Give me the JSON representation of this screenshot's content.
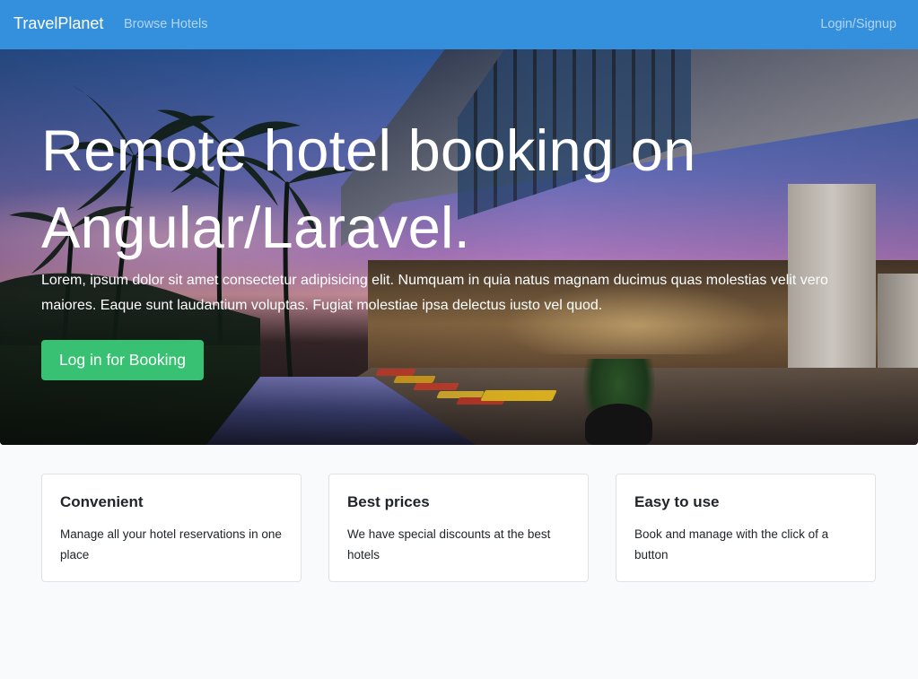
{
  "navbar": {
    "brand": "TravelPlanet",
    "browse_label": "Browse Hotels",
    "login_label": "Login/Signup"
  },
  "hero": {
    "title": "Remote hotel booking on Angular/Laravel.",
    "text": "Lorem, ipsum dolor sit amet consectetur adipisicing elit. Numquam in quia natus magnam ducimus quas molestias velit vero maiores. Eaque sunt laudantium voluptas. Fugiat molestiae ipsa delectus iusto vel quod.",
    "button_label": "Log in for Booking"
  },
  "features": [
    {
      "title": "Convenient",
      "text": "Manage all your hotel reservations in one place"
    },
    {
      "title": "Best prices",
      "text": "We have special discounts at the best hotels"
    },
    {
      "title": "Easy to use",
      "text": "Book and manage with the click of a button"
    }
  ],
  "colors": {
    "navbar": "#3490dc",
    "button": "#38c172",
    "page_background": "#f8fafc"
  }
}
